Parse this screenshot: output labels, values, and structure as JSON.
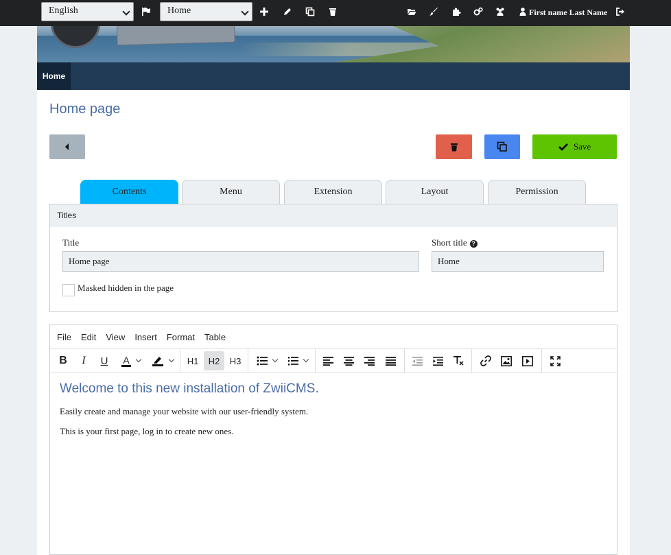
{
  "adminbar": {
    "language_select": "English",
    "page_select": "Home",
    "user_name": "First name Last Name"
  },
  "nav": {
    "home": "Home"
  },
  "page": {
    "title": "Home page"
  },
  "buttons": {
    "save": "Save"
  },
  "tabs": [
    {
      "label": "Contents",
      "active": true
    },
    {
      "label": "Menu"
    },
    {
      "label": "Extension"
    },
    {
      "label": "Layout"
    },
    {
      "label": "Permission"
    }
  ],
  "titles_panel": {
    "heading": "Titles",
    "title_label": "Title",
    "title_value": "Home page",
    "short_title_label": "Short title",
    "short_title_value": "Home",
    "masked_label": "Masked hidden in the page"
  },
  "editor": {
    "menu": [
      "File",
      "Edit",
      "View",
      "Insert",
      "Format",
      "Table"
    ],
    "toolbar": {
      "h1": "H1",
      "h2": "H2",
      "h3": "H3",
      "bold": "B",
      "italic": "I",
      "underline": "U",
      "forecolor": "A"
    },
    "content": {
      "heading": "Welcome to this new installation of ZwiiCMS.",
      "paragraphs": [
        "Easily create and manage your website with our user-friendly system.",
        "This is your first page, log in to create new ones."
      ]
    }
  },
  "colors": {
    "adminbar_bg": "#212223",
    "nav_bg": "#213a55",
    "accent_tab": "#00b4fb",
    "save": "#5ec300",
    "delete": "#e0604c",
    "duplicate": "#4a86f0",
    "title_blue": "#4a6da7"
  }
}
